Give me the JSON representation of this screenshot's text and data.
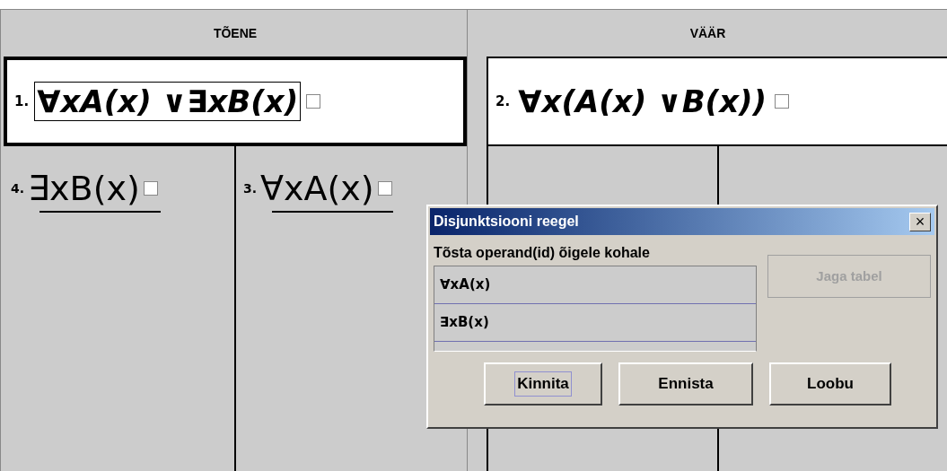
{
  "columns": [
    {
      "header": "TÕENE",
      "root": {
        "number": "1.",
        "formula": "∀xA(x) ∨∃xB(x)",
        "selected": true,
        "checked": false
      },
      "split": true,
      "branches": [
        {
          "number": "4.",
          "formula": "∃xB(x)",
          "checked": false
        },
        {
          "number": "3.",
          "formula": "∀xA(x)",
          "checked": false
        }
      ]
    },
    {
      "header": "VÄÄR",
      "root": {
        "number": "2.",
        "formula": "∀x(A(x) ∨B(x))",
        "selected": false,
        "checked": false
      },
      "split": true
    }
  ],
  "dialog": {
    "title": "Disjunktsiooni reegel",
    "close": "×",
    "label": "Tõsta operand(id) õigele kohale",
    "operands": [
      "∀xA(x)",
      "∃xB(x)"
    ],
    "side_button": {
      "label": "Jaga tabel",
      "disabled": true
    },
    "buttons": [
      {
        "label": "Kinnita",
        "focused": true
      },
      {
        "label": "Ennista",
        "focused": false
      },
      {
        "label": "Loobu",
        "focused": false
      }
    ]
  }
}
